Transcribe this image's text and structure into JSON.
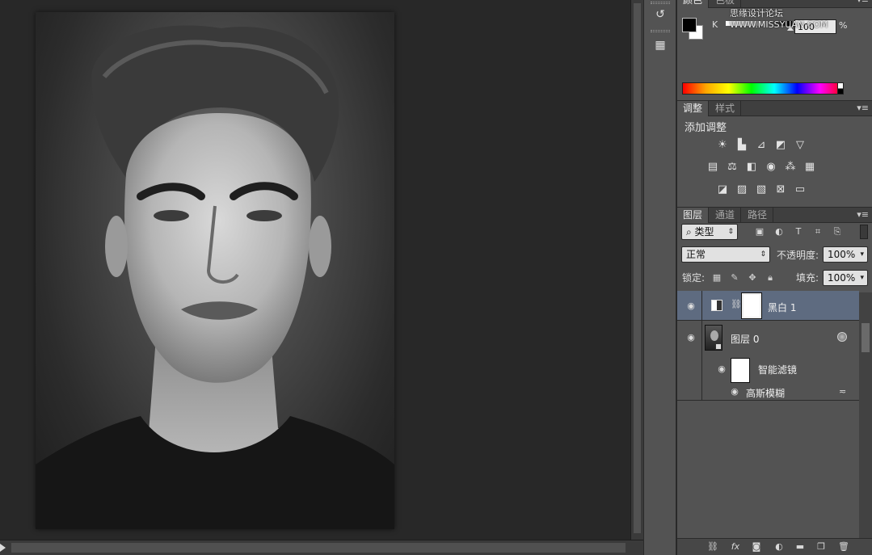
{
  "watermark": "思缘设计论坛 WWW.MISSYUAN.COM",
  "color_panel": {
    "tabs": [
      "颜色",
      "色板"
    ],
    "channel_label": "K",
    "k_value": "100",
    "percent_sign": "%",
    "fg_color": "#000000",
    "bg_color": "#ffffff"
  },
  "adjustments_panel": {
    "tabs": [
      "调整",
      "样式"
    ],
    "title": "添加调整",
    "row1_icons": [
      "brightness-contrast-icon",
      "levels-icon",
      "curves-icon",
      "exposure-icon",
      "vibrance-icon"
    ],
    "row2_icons": [
      "hue-saturation-icon",
      "color-balance-icon",
      "black-white-icon",
      "photo-filter-icon",
      "channel-mixer-icon",
      "color-lookup-icon"
    ],
    "row3_icons": [
      "invert-icon",
      "posterize-icon",
      "threshold-icon",
      "selective-color-icon",
      "gradient-map-icon"
    ]
  },
  "layers_panel": {
    "tabs": [
      "图层",
      "通道",
      "路径"
    ],
    "filter_kind": "类型",
    "blend_mode": "正常",
    "opacity_label": "不透明度:",
    "opacity_value": "100%",
    "lock_label": "锁定:",
    "fill_label": "填充:",
    "fill_value": "100%",
    "layers": [
      {
        "name": "黑白 1",
        "type": "adjustment",
        "selected": true
      },
      {
        "name": "图层 0",
        "type": "smart-object",
        "selected": false
      }
    ],
    "smart_filter_label": "智能滤镜",
    "filter_name": "高斯模糊"
  }
}
